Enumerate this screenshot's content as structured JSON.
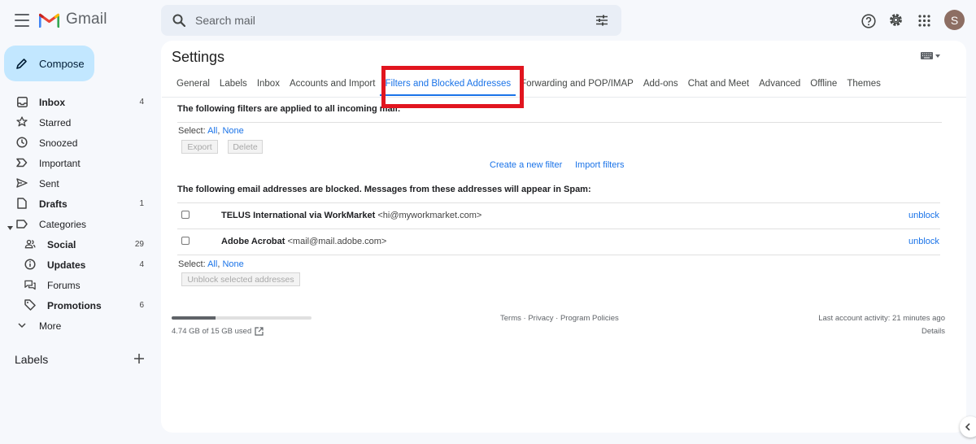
{
  "app": {
    "name": "Gmail"
  },
  "search": {
    "placeholder": "Search mail"
  },
  "user": {
    "initial": "S"
  },
  "compose": {
    "label": "Compose"
  },
  "nav": [
    {
      "label": "Inbox",
      "count": "4",
      "icon": "inbox-icon"
    },
    {
      "label": "Starred",
      "count": "",
      "icon": "star-icon"
    },
    {
      "label": "Snoozed",
      "count": "",
      "icon": "clock-icon"
    },
    {
      "label": "Important",
      "count": "",
      "icon": "important-icon"
    },
    {
      "label": "Sent",
      "count": "",
      "icon": "send-icon"
    },
    {
      "label": "Drafts",
      "count": "1",
      "icon": "draft-icon"
    },
    {
      "label": "Categories",
      "count": "",
      "icon": "label-icon"
    },
    {
      "label": "Social",
      "count": "29",
      "icon": "people-icon"
    },
    {
      "label": "Updates",
      "count": "4",
      "icon": "info-icon"
    },
    {
      "label": "Forums",
      "count": "",
      "icon": "forum-icon"
    },
    {
      "label": "Promotions",
      "count": "6",
      "icon": "tag-icon"
    },
    {
      "label": "More",
      "count": "",
      "icon": "chevron-down-icon"
    }
  ],
  "labels": {
    "header": "Labels"
  },
  "settings": {
    "title": "Settings",
    "tabs": [
      "General",
      "Labels",
      "Inbox",
      "Accounts and Import",
      "Filters and Blocked Addresses",
      "Forwarding and POP/IMAP",
      "Add-ons",
      "Chat and Meet",
      "Advanced",
      "Offline",
      "Themes"
    ],
    "active_tab": "Filters and Blocked Addresses"
  },
  "filters": {
    "heading": "The following filters are applied to all incoming mail:",
    "select_label": "Select:",
    "all": "All",
    "none": "None",
    "export": "Export",
    "delete": "Delete",
    "create": "Create a new filter",
    "import": "Import filters"
  },
  "blocked": {
    "heading": "The following email addresses are blocked. Messages from these addresses will appear in Spam:",
    "rows": [
      {
        "name": "TELUS International via WorkMarket",
        "email": "<hi@myworkmarket.com>",
        "action": "unblock"
      },
      {
        "name": "Adobe Acrobat",
        "email": "<mail@mail.adobe.com>",
        "action": "unblock"
      }
    ],
    "select_label": "Select:",
    "all": "All",
    "none": "None",
    "unblock_selected": "Unblock selected addresses"
  },
  "footer": {
    "storage": "4.74 GB of 15 GB used",
    "storage_fraction": 0.316,
    "terms": "Terms",
    "privacy": "Privacy",
    "policies": "Program Policies",
    "sep": "·",
    "activity": "Last account activity: 21 minutes ago",
    "details": "Details"
  },
  "colors": {
    "accent": "#1a73e8",
    "highlight_box": "#e1151f",
    "compose_bg": "#c2e7ff"
  }
}
